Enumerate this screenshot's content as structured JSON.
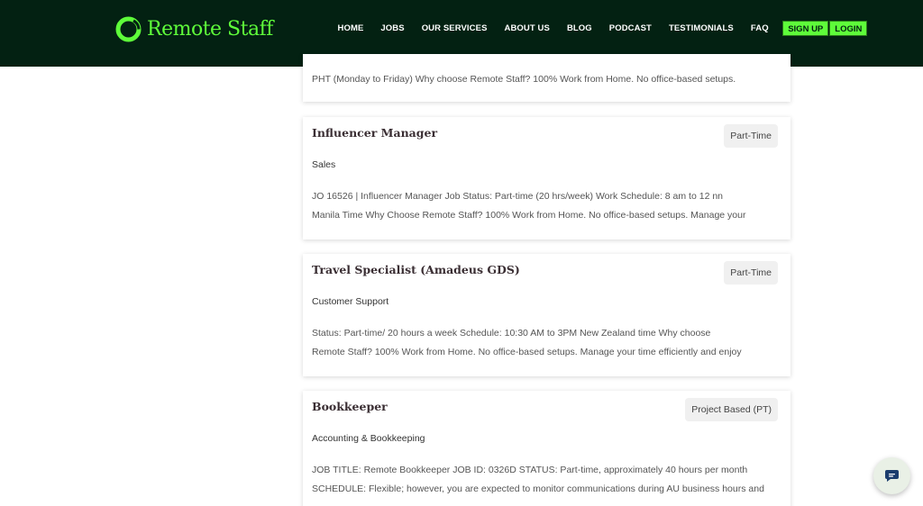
{
  "brand": {
    "name": "Remote Staff",
    "accent": "#5efc3a",
    "header_bg": "#032112"
  },
  "nav": {
    "items": [
      "HOME",
      "JOBS",
      "OUR SERVICES",
      "ABOUT US",
      "BLOG",
      "PODCAST",
      "TESTIMONIALS",
      "FAQ"
    ],
    "signup_label": "SIGN UP",
    "login_label": "LOGIN"
  },
  "partial_card": {
    "snippet": "PHT (Monday to Friday) Why choose Remote Staff? 100% Work from Home. No office-based setups."
  },
  "jobs": [
    {
      "title": "Influencer Manager",
      "type": "Part-Time",
      "category": "Sales",
      "desc_line1": "JO 16526  | Influencer Manager Job Status:  Part-time (20 hrs/week) Work Schedule:  8 am to 12 nn",
      "desc_line2": "Manila Time    Why Choose Remote Staff? 100% Work from Home. No office-based setups. Manage your"
    },
    {
      "title": "Travel Specialist (Amadeus GDS)",
      "type": "Part-Time",
      "category": "Customer Support",
      "desc_line1": "Status:  Part-time/ 20  hours a week Schedule: 10:30 AM to 3PM  New Zealand time     Why choose",
      "desc_line2": "Remote Staff? 100% Work from Home. No office-based setups. Manage your time efficiently and enjoy"
    },
    {
      "title": "Bookkeeper",
      "type": "Project Based (PT)",
      "category": "Accounting & Bookkeeping",
      "desc_line1": "JOB TITLE: Remote Bookkeeper   JOB ID: 0326D    STATUS: Part-time, approximately 40 hours per month",
      "desc_line2": "SCHEDULE: Flexible; however, you are expected to monitor communications during AU business hours and"
    }
  ],
  "chat": {
    "icon": "chat-bubble-icon"
  }
}
